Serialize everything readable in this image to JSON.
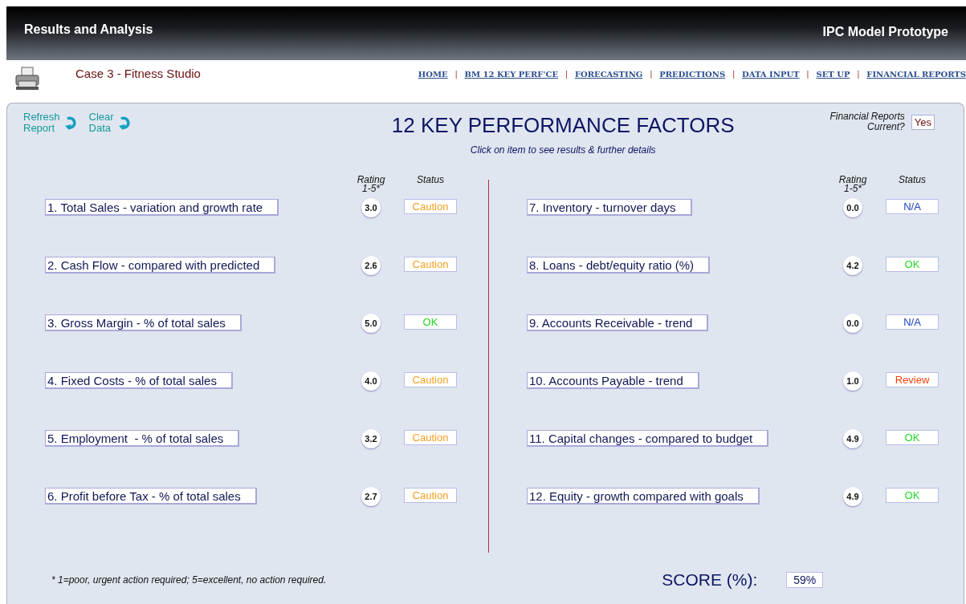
{
  "header": {
    "title": "Results and Analysis",
    "product": "IPC Model Prototype"
  },
  "case_name": "Case 3 - Fitness Studio",
  "nav": [
    {
      "label": "HOME"
    },
    {
      "separator": "|",
      "label": "BM 12 KEY PERF'CE"
    },
    {
      "separator": "|",
      "label": "FORECASTING"
    },
    {
      "separator": "|",
      "label": "PREDICTIONS"
    },
    {
      "separator": "|",
      "label": "DATA INPUT"
    },
    {
      "separator": "|",
      "label": "SET UP"
    },
    {
      "separator": "|",
      "label": "FINANCIAL REPORTS"
    }
  ],
  "actions": [
    {
      "line1": "Refresh",
      "line2": "Report"
    },
    {
      "line1": "Clear",
      "line2": "Data"
    }
  ],
  "title": "12 KEY PERFORMANCE FACTORS",
  "subtitle": "Click on item to see results & further details",
  "reports_current": {
    "label1": "Financial Reports",
    "label2": "Current?",
    "value": "Yes"
  },
  "columns": [
    {
      "rating_header1": "Rating",
      "rating_header2": "1-5*",
      "status_header": "Status",
      "factors": [
        {
          "label": "1. Total Sales - variation and growth rate",
          "rating": "3.0",
          "status": "Caution",
          "kind": "caution"
        },
        {
          "label": "2. Cash Flow - compared with predicted",
          "rating": "2.6",
          "status": "Caution",
          "kind": "caution"
        },
        {
          "label": "3. Gross Margin - % of total sales",
          "rating": "5.0",
          "status": "OK",
          "kind": "ok"
        },
        {
          "label": "4. Fixed Costs - % of total sales",
          "rating": "4.0",
          "status": "Caution",
          "kind": "caution"
        },
        {
          "label": "5. Employment  - % of total sales",
          "rating": "3.2",
          "status": "Caution",
          "kind": "caution"
        },
        {
          "label": "6. Profit before Tax - % of total sales",
          "rating": "2.7",
          "status": "Caution",
          "kind": "caution"
        }
      ]
    },
    {
      "rating_header1": "Rating",
      "rating_header2": "1-5*",
      "status_header": "Status",
      "factors": [
        {
          "label": "7. Inventory - turnover days",
          "rating": "0.0",
          "status": "N/A",
          "kind": "na"
        },
        {
          "label": "8. Loans - debt/equity ratio (%)",
          "rating": "4.2",
          "status": "OK",
          "kind": "ok"
        },
        {
          "label": "9. Accounts Receivable - trend",
          "rating": "0.0",
          "status": "N/A",
          "kind": "na"
        },
        {
          "label": "10. Accounts Payable - trend",
          "rating": "1.0",
          "status": "Review",
          "kind": "review"
        },
        {
          "label": "11. Capital changes - compared to budget",
          "rating": "4.9",
          "status": "OK",
          "kind": "ok"
        },
        {
          "label": "12. Equity - growth compared with goals",
          "rating": "4.9",
          "status": "OK",
          "kind": "ok"
        }
      ]
    }
  ],
  "footnote": "* 1=poor, urgent action required;  5=excellent, no action required.",
  "score": {
    "label": "SCORE (%):",
    "value": "59%"
  }
}
